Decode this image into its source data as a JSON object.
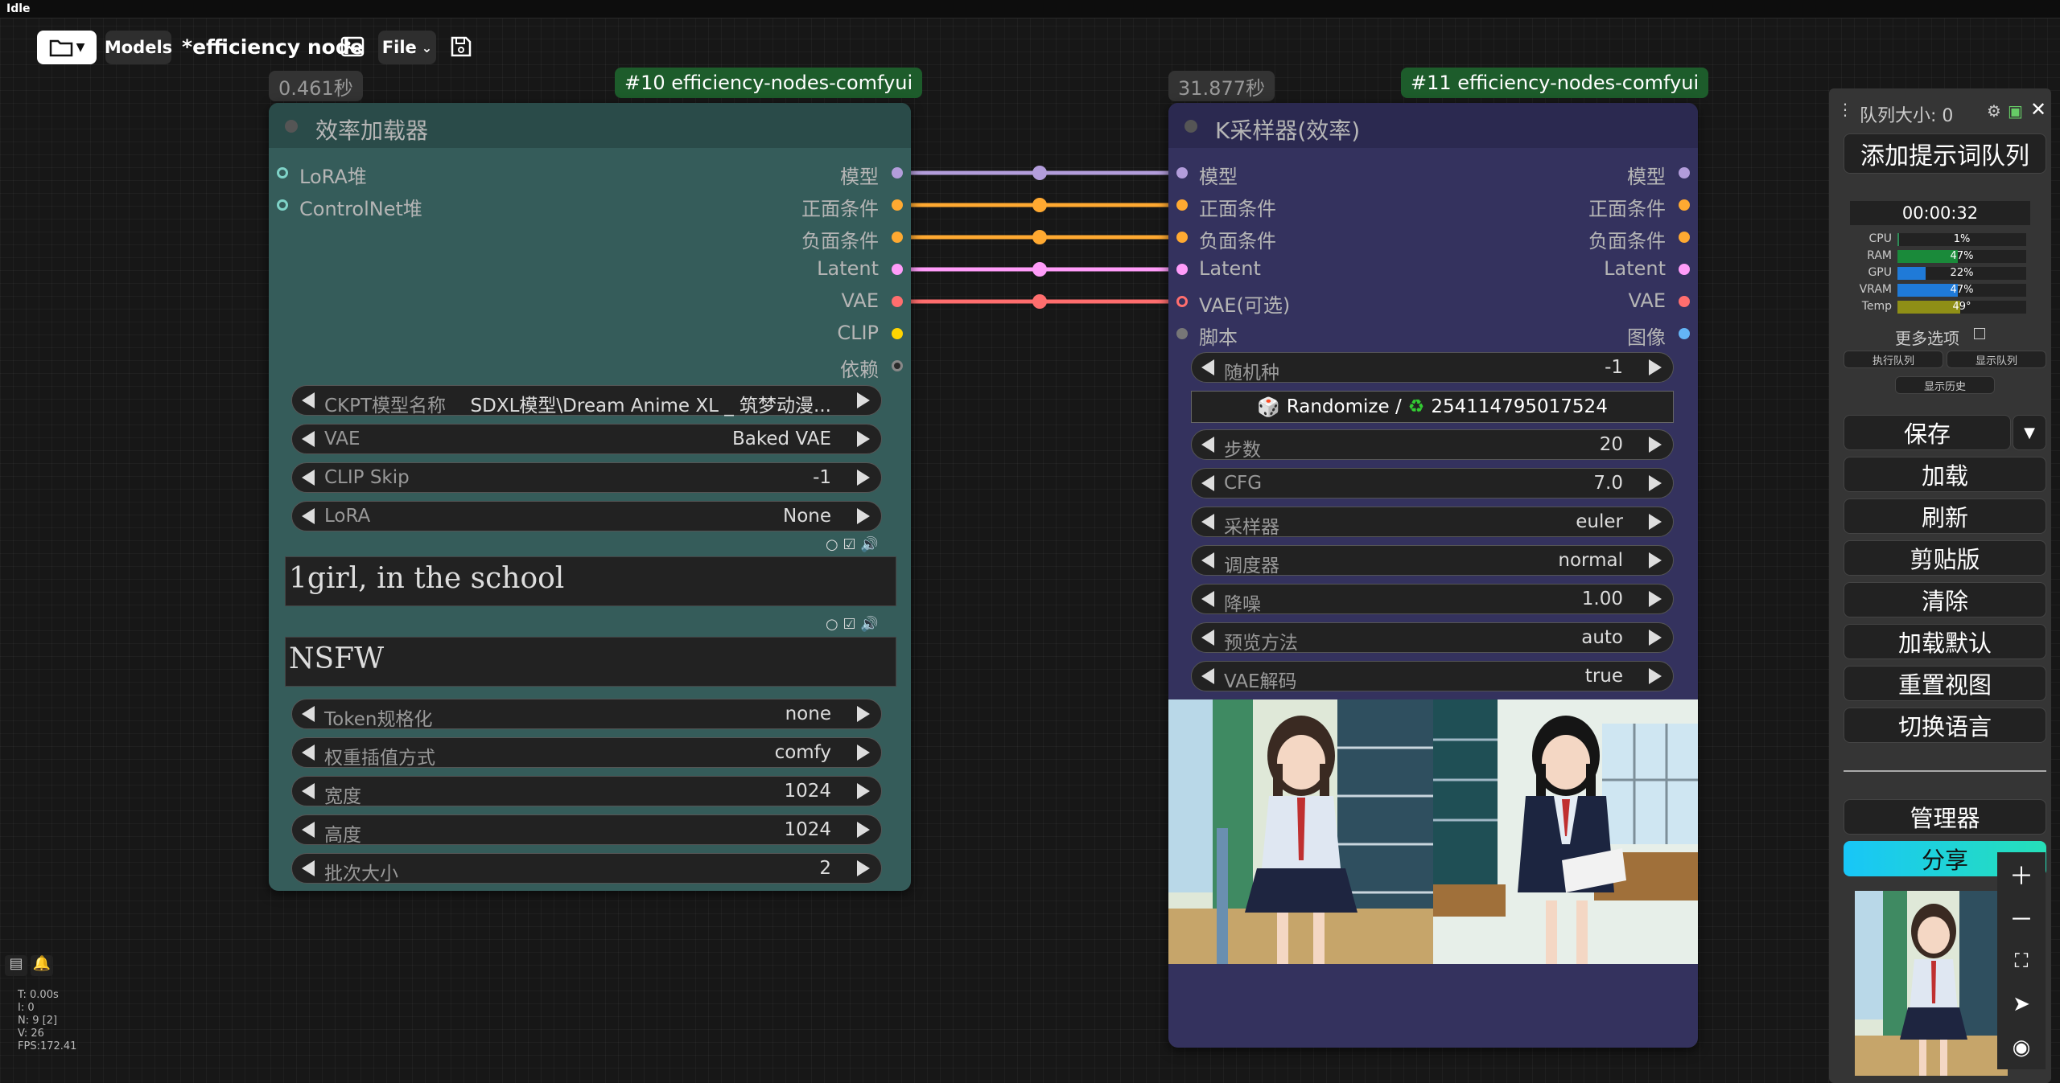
{
  "status": "Idle",
  "toolbar": {
    "models_label": "Models",
    "workflow_name": "*efficiency node",
    "file_label": "File"
  },
  "node_loader": {
    "time": "0.461秒",
    "id_label": "#10 efficiency-nodes-comfyui",
    "title": "效率加载器",
    "inputs": [
      "LoRA堆",
      "ControlNet堆"
    ],
    "outputs": [
      "模型",
      "正面条件",
      "负面条件",
      "Latent",
      "VAE",
      "CLIP",
      "依赖"
    ],
    "widgets_top": [
      {
        "label": "CKPT模型名称",
        "value": "SDXL模型\\Dream Anime XL _ 筑梦动漫..."
      },
      {
        "label": "VAE",
        "value": "Baked VAE"
      },
      {
        "label": "CLIP Skip",
        "value": "-1"
      },
      {
        "label": "LoRA",
        "value": "None"
      }
    ],
    "positive_prompt": "1girl, in the school",
    "negative_prompt": "NSFW",
    "widgets_bottom": [
      {
        "label": "Token规格化",
        "value": "none"
      },
      {
        "label": "权重插值方式",
        "value": "comfy"
      },
      {
        "label": "宽度",
        "value": "1024"
      },
      {
        "label": "高度",
        "value": "1024"
      },
      {
        "label": "批次大小",
        "value": "2"
      }
    ]
  },
  "node_sampler": {
    "time": "31.877秒",
    "id_label": "#11 efficiency-nodes-comfyui",
    "title": "K采样器(效率)",
    "inputs": [
      "模型",
      "正面条件",
      "负面条件",
      "Latent",
      "VAE(可选)",
      "脚本"
    ],
    "outputs": [
      "模型",
      "正面条件",
      "负面条件",
      "Latent",
      "VAE",
      "图像"
    ],
    "seed_widget": {
      "label": "随机种",
      "value": "-1"
    },
    "randomize_label": "Randomize /",
    "randomize_seed": "254114795017524",
    "widgets": [
      {
        "label": "步数",
        "value": "20"
      },
      {
        "label": "CFG",
        "value": "7.0"
      },
      {
        "label": "采样器",
        "value": "euler"
      },
      {
        "label": "调度器",
        "value": "normal"
      },
      {
        "label": "降噪",
        "value": "1.00"
      },
      {
        "label": "预览方法",
        "value": "auto"
      },
      {
        "label": "VAE解码",
        "value": "true"
      }
    ]
  },
  "sidebar": {
    "queue_size": "队列大小: 0",
    "queue_prompt": "添加提示词队列",
    "timer": "00:00:32",
    "stats": [
      {
        "label": "CPU",
        "value": "1%",
        "fraction": 0.01,
        "color": "#2e8b57"
      },
      {
        "label": "RAM",
        "value": "47%",
        "fraction": 0.47,
        "color": "#1a8a3a"
      },
      {
        "label": "GPU",
        "value": "22%",
        "fraction": 0.22,
        "color": "#1f7ad8"
      },
      {
        "label": "VRAM",
        "value": "47%",
        "fraction": 0.47,
        "color": "#1f7ad8"
      },
      {
        "label": "Temp",
        "value": "49°",
        "fraction": 0.49,
        "color": "#8f8f16"
      }
    ],
    "more_options": "更多选项",
    "exec_queue": "执行队列",
    "show_queue": "显示队列",
    "show_history": "显示历史",
    "buttons": [
      "保存",
      "加载",
      "刷新",
      "剪贴版",
      "清除",
      "加载默认",
      "重置视图",
      "切换语言"
    ],
    "manager": "管理器",
    "share": "分享"
  },
  "stats": [
    "T: 0.00s",
    "I: 0",
    "N: 9 [2]",
    "V: 26",
    "FPS:172.41"
  ],
  "colors": {
    "loader_body": "#355c5a",
    "loader_title": "#2a4b49",
    "sampler_body": "#34325e",
    "sampler_title": "#2b2950",
    "model": "#b39ddb",
    "conditioning": "#ffa931",
    "latent": "#ff9cf9",
    "vae": "#ff6e6e",
    "clip": "#ffd500",
    "image": "#64b5f6"
  }
}
